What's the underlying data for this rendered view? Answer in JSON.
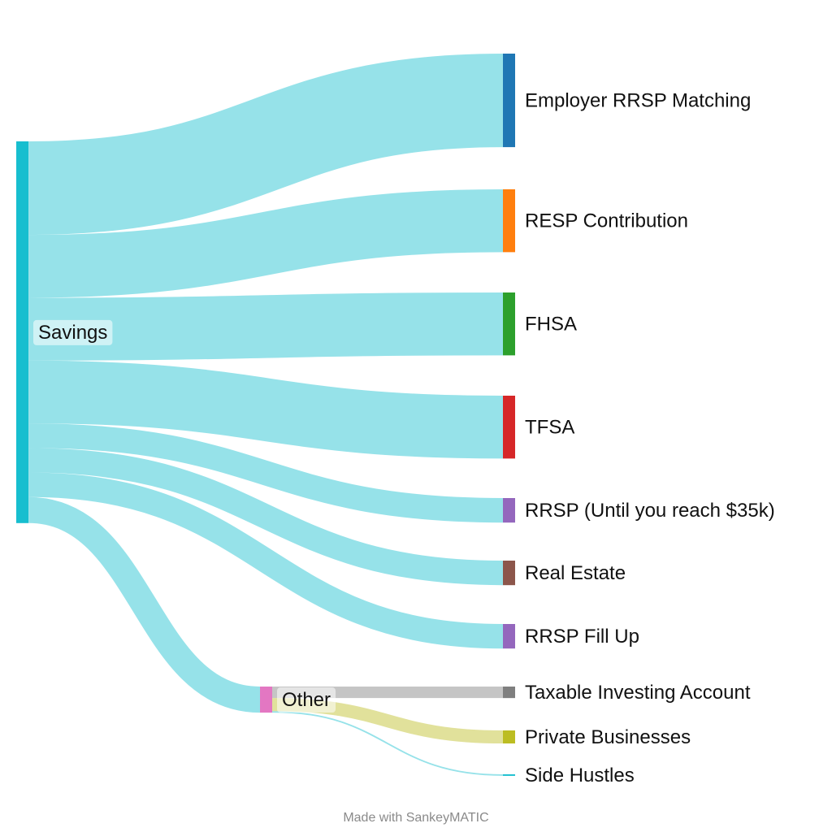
{
  "chart_data": {
    "type": "sankey",
    "title": "",
    "units": "relative flow amount (estimated from band widths)",
    "nodes": [
      {
        "id": "Savings",
        "label": "Savings",
        "color": "#17becf",
        "column": 0
      },
      {
        "id": "Employer RRSP Matching",
        "label": "Employer RRSP Matching",
        "color": "#1f77b4",
        "column": 2
      },
      {
        "id": "RESP Contribution",
        "label": "RESP Contribution",
        "color": "#ff7f0e",
        "column": 2
      },
      {
        "id": "FHSA",
        "label": "FHSA",
        "color": "#2ca02c",
        "column": 2
      },
      {
        "id": "TFSA",
        "label": "TFSA",
        "color": "#d62728",
        "column": 2
      },
      {
        "id": "RRSP (Until you reach $35k)",
        "label": "RRSP (Until you reach $35k)",
        "color": "#9467bd",
        "column": 2
      },
      {
        "id": "Real Estate",
        "label": "Real Estate",
        "color": "#8c564b",
        "column": 2
      },
      {
        "id": "RRSP Fill Up",
        "label": "RRSP Fill Up",
        "color": "#9467bd",
        "column": 2
      },
      {
        "id": "Other",
        "label": "Other",
        "color": "#e377c2",
        "column": 1
      },
      {
        "id": "Taxable Investing Account",
        "label": "Taxable Investing Account",
        "color": "#7f7f7f",
        "column": 2
      },
      {
        "id": "Private Businesses",
        "label": "Private Businesses",
        "color": "#bcbd22",
        "column": 2
      },
      {
        "id": "Side Hustles",
        "label": "Side Hustles",
        "color": "#17becf",
        "column": 2
      }
    ],
    "links": [
      {
        "source": "Savings",
        "target": "Employer RRSP Matching",
        "value": 122,
        "color": "#17becf"
      },
      {
        "source": "Savings",
        "target": "RESP Contribution",
        "value": 82,
        "color": "#17becf"
      },
      {
        "source": "Savings",
        "target": "FHSA",
        "value": 82,
        "color": "#17becf"
      },
      {
        "source": "Savings",
        "target": "TFSA",
        "value": 82,
        "color": "#17becf"
      },
      {
        "source": "Savings",
        "target": "RRSP (Until you reach $35k)",
        "value": 32,
        "color": "#17becf"
      },
      {
        "source": "Savings",
        "target": "Real Estate",
        "value": 32,
        "color": "#17becf"
      },
      {
        "source": "Savings",
        "target": "RRSP Fill Up",
        "value": 32,
        "color": "#17becf"
      },
      {
        "source": "Savings",
        "target": "Other",
        "value": 34,
        "color": "#17becf"
      },
      {
        "source": "Other",
        "target": "Taxable Investing Account",
        "value": 15,
        "color": "#7f7f7f"
      },
      {
        "source": "Other",
        "target": "Private Businesses",
        "value": 17,
        "color": "#bcbd22"
      },
      {
        "source": "Other",
        "target": "Side Hustles",
        "value": 2,
        "color": "#17becf"
      }
    ]
  },
  "footer": {
    "credit": "Made with SankeyMATIC"
  }
}
